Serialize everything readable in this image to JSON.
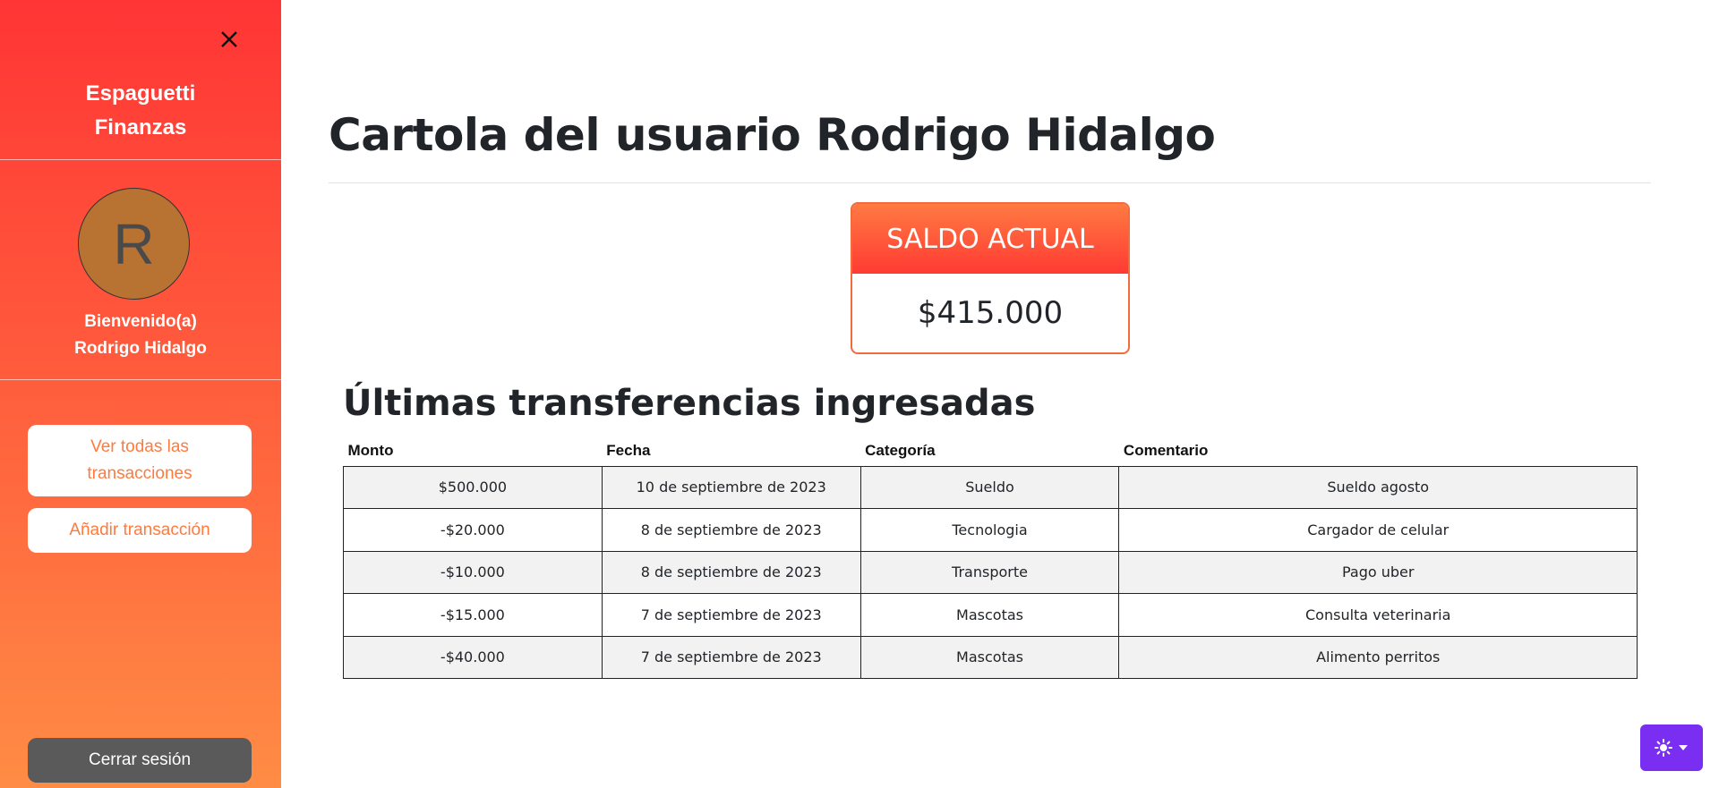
{
  "sidebar": {
    "brand_line1": "Espaguetti",
    "brand_line2": "Finanzas",
    "avatar_initial": "R",
    "welcome_line1": "Bienvenido(a)",
    "welcome_line2": "Rodrigo Hidalgo",
    "btn_all_transactions_line1": "Ver todas las",
    "btn_all_transactions_line2": "transacciones",
    "btn_add_transaction": "Añadir transacción",
    "btn_logout": "Cerrar sesión"
  },
  "main": {
    "page_title": "Cartola del usuario Rodrigo Hidalgo",
    "balance_label": "SALDO ACTUAL",
    "balance_value": "$415.000",
    "section_title": "Últimas transferencias ingresadas",
    "table": {
      "headers": [
        "Monto",
        "Fecha",
        "Categoría",
        "Comentario"
      ],
      "rows": [
        {
          "amount": "$500.000",
          "date": "10 de septiembre de 2023",
          "category": "Sueldo",
          "comment": "Sueldo agosto"
        },
        {
          "amount": "-$20.000",
          "date": "8 de septiembre de 2023",
          "category": "Tecnologia",
          "comment": "Cargador de celular"
        },
        {
          "amount": "-$10.000",
          "date": "8 de septiembre de 2023",
          "category": "Transporte",
          "comment": "Pago uber"
        },
        {
          "amount": "-$15.000",
          "date": "7 de septiembre de 2023",
          "category": "Mascotas",
          "comment": "Consulta veterinaria"
        },
        {
          "amount": "-$40.000",
          "date": "7 de septiembre de 2023",
          "category": "Mascotas",
          "comment": "Alimento perritos"
        }
      ]
    }
  },
  "colors": {
    "positive": "#1fae2a",
    "negative": "#e52020",
    "theme_button": "#7a2ef2"
  },
  "icons": {
    "close": "close-icon",
    "theme": "sun-icon",
    "dropdown": "caret-down-icon"
  }
}
